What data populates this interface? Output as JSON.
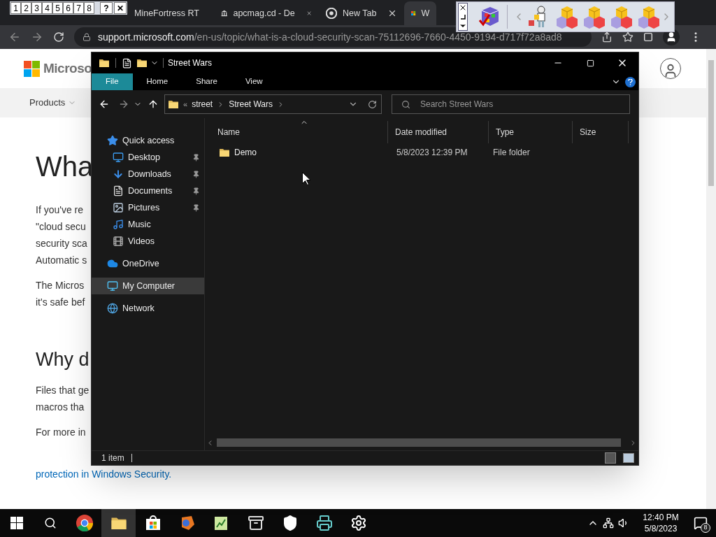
{
  "browser": {
    "tabs": [
      {
        "title": "MineFortress RT",
        "selected": false
      },
      {
        "title": "apcmag.cd - De",
        "kind": "building",
        "selected": false
      },
      {
        "title": "New Tab",
        "kind": "chrome",
        "selected": false
      },
      {
        "title": "W",
        "kind": "windows",
        "selected": true
      }
    ],
    "url_host": "support.microsoft.com",
    "url_path": "/en-us/topic/what-is-a-cloud-security-scan-75112696-7660-4450-9194-d717f72a8ad8",
    "page": {
      "logo": "Microso",
      "nav": [
        "Products"
      ],
      "heading": "Wha",
      "paragraphs": [
        [
          "If you've re",
          "\"cloud secu",
          "security sca",
          "Automatic s"
        ],
        [
          "The Micros",
          "it's safe bef"
        ]
      ],
      "heading2": "Why d",
      "paragraphs2": [
        [
          "Files that ge",
          "macros tha"
        ],
        [
          "For more in"
        ]
      ],
      "link": "protection in Windows Security."
    }
  },
  "explorer": {
    "title": "Street Wars",
    "ribbon_tabs": [
      {
        "label": "File",
        "selected": true
      },
      {
        "label": "Home",
        "selected": false
      },
      {
        "label": "Share",
        "selected": false
      },
      {
        "label": "View",
        "selected": false
      }
    ],
    "overflow": "«",
    "breadcrumb": [
      "street",
      "Street Wars"
    ],
    "search": {
      "placeholder": "Search Street Wars"
    },
    "tree": [
      {
        "label": "Quick access",
        "kind": "star",
        "selected": false,
        "children": [
          {
            "label": "Desktop",
            "kind": "desktop",
            "pinned": true,
            "selected": false
          },
          {
            "label": "Downloads",
            "kind": "download",
            "pinned": true,
            "selected": false
          },
          {
            "label": "Documents",
            "kind": "document",
            "pinned": true,
            "selected": false
          },
          {
            "label": "Pictures",
            "kind": "picture",
            "pinned": true,
            "selected": false
          },
          {
            "label": "Music",
            "kind": "music",
            "pinned": false,
            "selected": false
          },
          {
            "label": "Videos",
            "kind": "video",
            "pinned": false,
            "selected": false
          }
        ]
      },
      {
        "label": "OneDrive",
        "kind": "cloud",
        "selected": false
      },
      {
        "label": "My Computer",
        "kind": "computer",
        "selected": true
      },
      {
        "label": "Network",
        "kind": "network",
        "selected": false
      }
    ],
    "columns": [
      {
        "label": "Name",
        "sorted": true
      },
      {
        "label": "Date modified",
        "sorted": false
      },
      {
        "label": "Type",
        "sorted": false
      },
      {
        "label": "Size",
        "sorted": false
      }
    ],
    "rows": [
      {
        "name": "Demo",
        "date": "5/8/2023 12:39 PM",
        "type": "File folder"
      }
    ],
    "status": "1 item"
  },
  "numpad": {
    "keys": [
      "1",
      "2",
      "3",
      "4",
      "5",
      "6",
      "7",
      "8",
      "?",
      "✕"
    ]
  },
  "taskbar": {
    "apps": [
      {
        "kind": "chrome",
        "active": false
      },
      {
        "kind": "folder",
        "active": true
      },
      {
        "kind": "store",
        "active": false
      },
      {
        "kind": "paint",
        "active": false
      },
      {
        "kind": "chart",
        "active": false
      },
      {
        "kind": "cabinet",
        "active": false
      },
      {
        "kind": "shield",
        "active": false
      },
      {
        "kind": "machine",
        "active": false
      },
      {
        "kind": "gear",
        "active": false
      }
    ],
    "time": "12:40 PM",
    "date": "5/8/2023",
    "notifications": "8"
  }
}
